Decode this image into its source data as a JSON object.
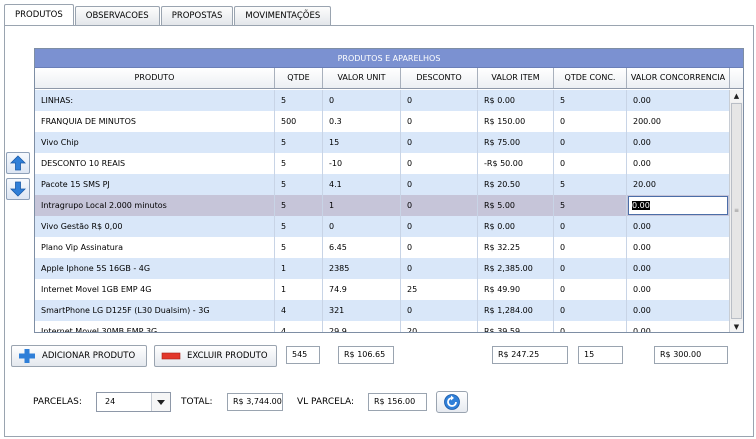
{
  "tabs": [
    {
      "label": "PRODUTOS",
      "active": true
    },
    {
      "label": "OBSERVACOES",
      "active": false
    },
    {
      "label": "PROPOSTAS",
      "active": false
    },
    {
      "label": "MOVIMENTAÇÕES",
      "active": false
    }
  ],
  "grid": {
    "title": "PRODUTOS E APARELHOS",
    "columns": [
      "PRODUTO",
      "QTDE",
      "VALOR UNIT",
      "DESCONTO",
      "VALOR ITEM",
      "QTDE CONC.",
      "VALOR CONCORRENCIA"
    ],
    "rows": [
      [
        "LINHAS:",
        "5",
        "0",
        "0",
        "R$ 0.00",
        "5",
        "0.00"
      ],
      [
        "FRANQUIA DE MINUTOS",
        "500",
        "0.3",
        "0",
        "R$ 150.00",
        "0",
        "200.00"
      ],
      [
        "Vivo Chip",
        "5",
        "15",
        "0",
        "R$ 75.00",
        "0",
        "0.00"
      ],
      [
        "DESCONTO 10 REAIS",
        "5",
        "-10",
        "0",
        "-R$ 50.00",
        "0",
        "0.00"
      ],
      [
        "Pacote 15 SMS PJ",
        "5",
        "4.1",
        "0",
        "R$ 20.50",
        "5",
        "20.00"
      ],
      [
        "Intragrupo Local 2.000 minutos",
        "5",
        "1",
        "0",
        "R$ 5.00",
        "5",
        "0.00"
      ],
      [
        "Vivo Gestão R$ 0,00",
        "5",
        "0",
        "0",
        "R$ 0.00",
        "0",
        "0.00"
      ],
      [
        "Plano Vip Assinatura",
        "5",
        "6.45",
        "0",
        "R$ 32.25",
        "0",
        "0.00"
      ],
      [
        "Apple Iphone 5S 16GB - 4G",
        "1",
        "2385",
        "0",
        "R$ 2,385.00",
        "0",
        "0.00"
      ],
      [
        "Internet Movel 1GB EMP 4G",
        "1",
        "74.9",
        "25",
        "R$ 49.90",
        "0",
        "0.00"
      ],
      [
        "SmartPhone LG D125F (L30 Dualsim) - 3G",
        "4",
        "321",
        "0",
        "R$ 1,284.00",
        "0",
        "0.00"
      ],
      [
        "Internet Movel 30MB EMP 3G",
        "4",
        "29.9",
        "20",
        "R$ 39.59",
        "0",
        "0.00"
      ]
    ],
    "selected_row": 5,
    "editing_value": "0.00"
  },
  "buttons": {
    "add": "ADICIONAR PRODUTO",
    "delete": "EXCLUIR PRODUTO"
  },
  "totals": {
    "qtde": "545",
    "valor_unit": "R$ 106.65",
    "valor_item": "R$ 247.25",
    "qtde_conc": "15",
    "valor_conc": "R$ 300.00"
  },
  "footer": {
    "parcelas_label": "PARCELAS:",
    "parcelas_value": "24",
    "total_label": "TOTAL:",
    "total_value": "R$ 3,744.00",
    "vl_parcela_label": "VL PARCELA:",
    "vl_parcela_value": "R$ 156.00"
  },
  "colors": {
    "grid_title_bg": "#7b91d1",
    "row_alt_bg": "#d9e7f9",
    "row_selected_bg": "#c6c5d9",
    "add_icon": "#2f7fd8",
    "delete_icon": "#e2372b"
  },
  "icons": [
    "arrow-up-icon",
    "arrow-down-icon",
    "plus-icon",
    "minus-icon",
    "chevron-down-icon",
    "refresh-icon"
  ]
}
